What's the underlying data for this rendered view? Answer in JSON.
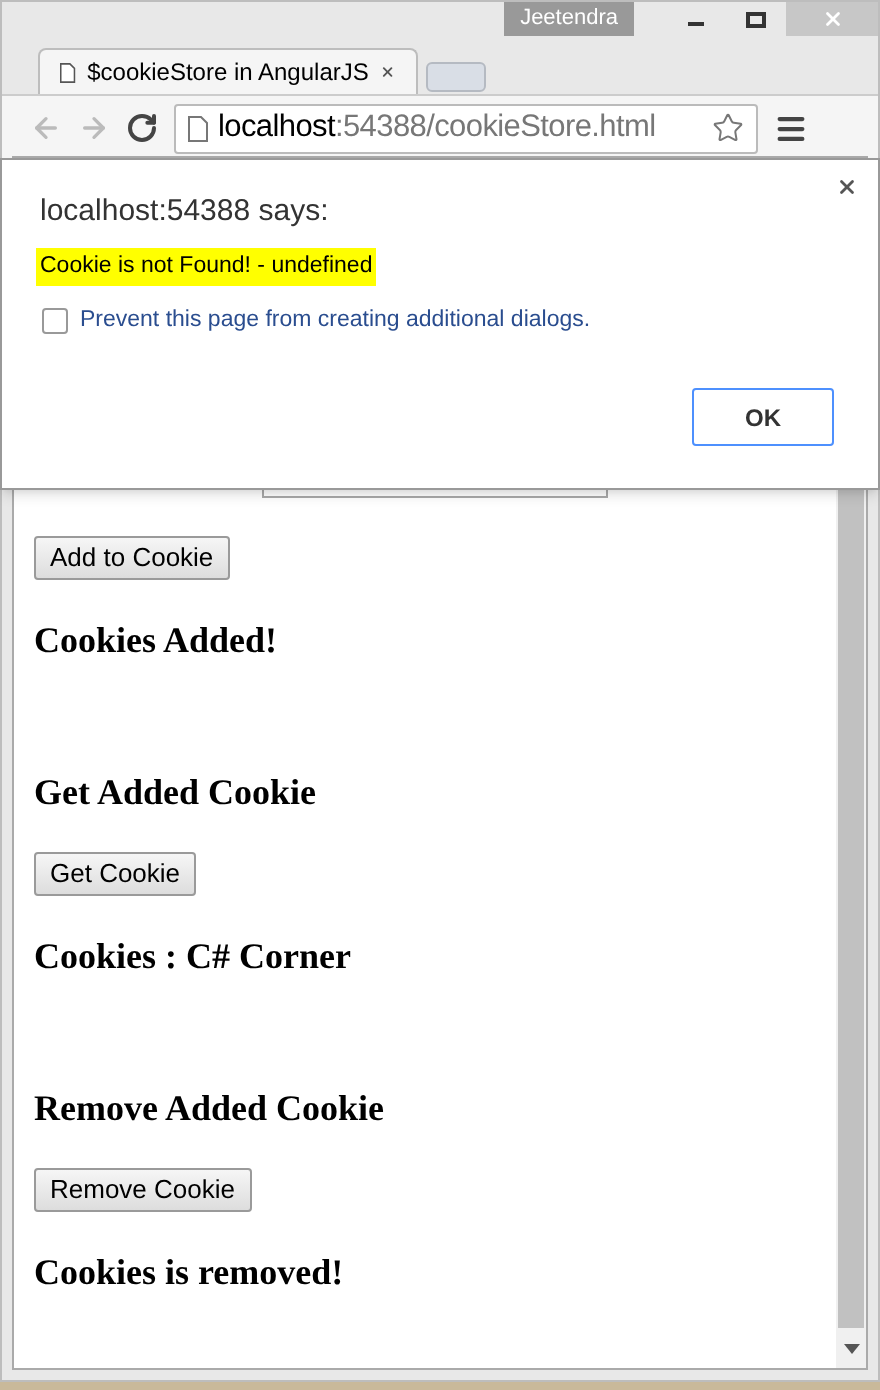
{
  "window": {
    "user": "Jeetendra"
  },
  "tabs": [
    {
      "title": "$cookieStore in AngularJS",
      "selected": true
    }
  ],
  "address_bar": {
    "host": "localhost",
    "path": ":54388/cookieStore.html"
  },
  "dialog": {
    "title": "localhost:54388 says:",
    "message": "Cookie is not Found! - undefined",
    "option": {
      "label": "Prevent this page from creating additional dialogs.",
      "checked": false
    },
    "button": "OK"
  },
  "page": [
    {
      "kind": "field"
    },
    {
      "kind": "button",
      "label": "Add to Cookie"
    },
    {
      "kind": "heading",
      "text": "Cookies Added!"
    },
    {
      "kind": "spacer"
    },
    {
      "kind": "heading",
      "text": "Get Added Cookie"
    },
    {
      "kind": "button",
      "label": "Get Cookie"
    },
    {
      "kind": "heading",
      "text": "Cookies : C# Corner"
    },
    {
      "kind": "spacer"
    },
    {
      "kind": "heading",
      "text": "Remove Added Cookie"
    },
    {
      "kind": "button",
      "label": "Remove Cookie"
    },
    {
      "kind": "heading",
      "text": "Cookies is removed!"
    }
  ]
}
